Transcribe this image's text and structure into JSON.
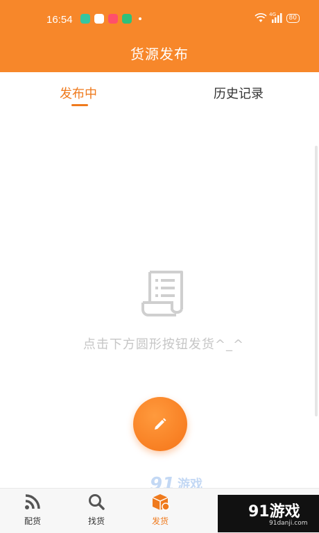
{
  "status_bar": {
    "time": "16:54",
    "network": "4G",
    "battery": "80"
  },
  "header": {
    "title": "货源发布"
  },
  "tabs": [
    {
      "label": "发布中",
      "active": true
    },
    {
      "label": "历史记录",
      "active": false
    }
  ],
  "empty_state": {
    "icon": "receipt-icon",
    "message": "点击下方圆形按钮发货^_^"
  },
  "fab": {
    "icon": "pencil-icon"
  },
  "bottom_nav": [
    {
      "label": "配货",
      "icon": "rss-icon",
      "active": false
    },
    {
      "label": "找货",
      "icon": "search-icon",
      "active": false
    },
    {
      "label": "发货",
      "icon": "box-icon",
      "active": true
    }
  ],
  "watermark": {
    "brand": "91游戏",
    "site": "91danji.com"
  },
  "colors": {
    "brand_orange": "#f7872a",
    "accent_orange": "#ef7a1d",
    "muted_text": "#c6c6c6"
  }
}
